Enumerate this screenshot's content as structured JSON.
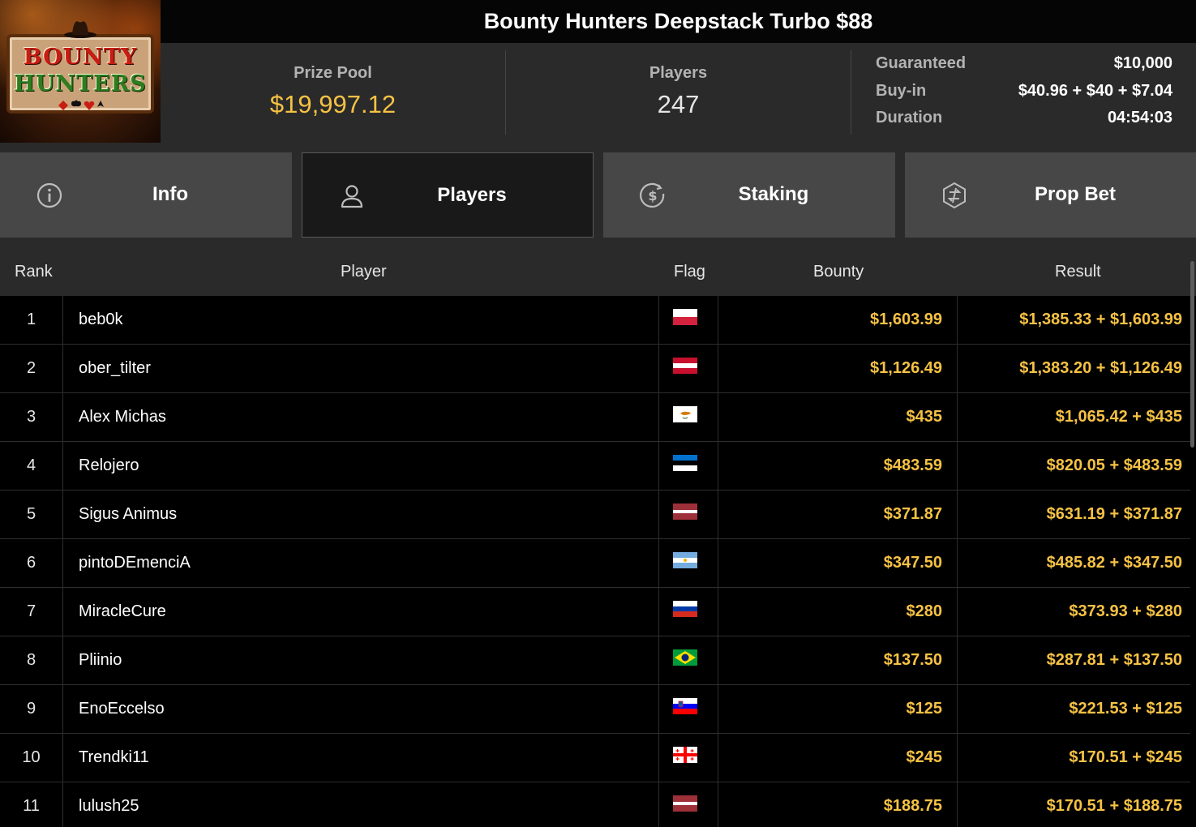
{
  "logo": {
    "line1": "BOUNTY",
    "line2": "HUNTERS"
  },
  "header": {
    "title": "Bounty Hunters Deepstack Turbo $88",
    "prize_pool_label": "Prize Pool",
    "prize_pool_value": "$19,997.12",
    "players_label": "Players",
    "players_value": "247",
    "details": {
      "guaranteed_label": "Guaranteed",
      "guaranteed_value": "$10,000",
      "buyin_label": "Buy-in",
      "buyin_value": "$40.96 + $40 + $7.04",
      "duration_label": "Duration",
      "duration_value": "04:54:03"
    }
  },
  "tabs": [
    {
      "label": "Info",
      "icon": "info-icon",
      "active": false
    },
    {
      "label": "Players",
      "icon": "user-icon",
      "active": true
    },
    {
      "label": "Staking",
      "icon": "dollar-circle-icon",
      "active": false
    },
    {
      "label": "Prop Bet",
      "icon": "prop-bet-icon",
      "active": false
    }
  ],
  "table": {
    "columns": {
      "rank": "Rank",
      "player": "Player",
      "flag": "Flag",
      "bounty": "Bounty",
      "result": "Result"
    },
    "rows": [
      {
        "rank": "1",
        "player": "beb0k",
        "flag": "poland-flag",
        "bounty": "$1,603.99",
        "result": "$1,385.33 + $1,603.99"
      },
      {
        "rank": "2",
        "player": "ober_tilter",
        "flag": "austria-flag",
        "bounty": "$1,126.49",
        "result": "$1,383.20 + $1,126.49"
      },
      {
        "rank": "3",
        "player": "Alex Michas",
        "flag": "cyprus-flag",
        "bounty": "$435",
        "result": "$1,065.42 + $435"
      },
      {
        "rank": "4",
        "player": "Relojero",
        "flag": "estonia-flag",
        "bounty": "$483.59",
        "result": "$820.05 + $483.59"
      },
      {
        "rank": "5",
        "player": "Sigus Animus",
        "flag": "latvia-flag",
        "bounty": "$371.87",
        "result": "$631.19 + $371.87"
      },
      {
        "rank": "6",
        "player": "pintoDEmenciA",
        "flag": "argentina-flag",
        "bounty": "$347.50",
        "result": "$485.82 + $347.50"
      },
      {
        "rank": "7",
        "player": "MiracleCure",
        "flag": "russia-flag",
        "bounty": "$280",
        "result": "$373.93 + $280"
      },
      {
        "rank": "8",
        "player": "Pliinio",
        "flag": "brazil-flag",
        "bounty": "$137.50",
        "result": "$287.81 + $137.50"
      },
      {
        "rank": "9",
        "player": "EnoEccelso",
        "flag": "slovenia-flag",
        "bounty": "$125",
        "result": "$221.53 + $125"
      },
      {
        "rank": "10",
        "player": "Trendki11",
        "flag": "georgia-flag",
        "bounty": "$245",
        "result": "$170.51 + $245"
      },
      {
        "rank": "11",
        "player": "lulush25",
        "flag": "latvia-flag",
        "bounty": "$188.75",
        "result": "$170.51 + $188.75"
      }
    ]
  },
  "colors": {
    "accent_gold": "#f6c244",
    "panel": "#2a2a2a",
    "tab": "#474747",
    "tab_active": "#191919"
  }
}
